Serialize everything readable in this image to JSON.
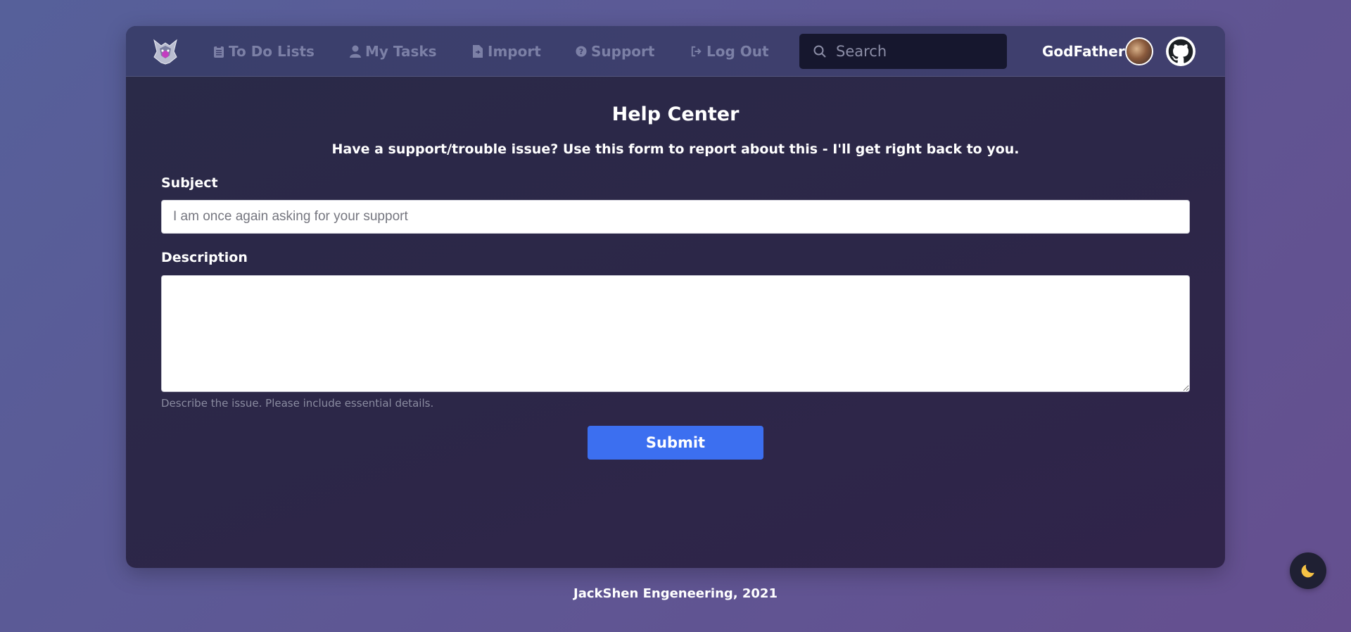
{
  "nav": {
    "items": [
      {
        "label": "To Do Lists",
        "icon": "clipboard-icon"
      },
      {
        "label": "My Tasks",
        "icon": "user-icon"
      },
      {
        "label": "Import",
        "icon": "file-import-icon"
      },
      {
        "label": "Support",
        "icon": "question-circle-icon"
      },
      {
        "label": "Log Out",
        "icon": "sign-out-icon"
      }
    ],
    "search_placeholder": "Search",
    "username": "GodFather"
  },
  "form": {
    "title": "Help Center",
    "subtitle": "Have a support/trouble issue? Use this form to report about this - I'll get right back to you.",
    "subject_label": "Subject",
    "subject_placeholder": "I am once again asking for your support",
    "description_label": "Description",
    "description_value": "",
    "description_hint": "Describe the issue. Please include essential details.",
    "submit_label": "Submit"
  },
  "footer": {
    "text": "JackShen Engeneering, 2021"
  },
  "colors": {
    "accent": "#3c6ff0",
    "nav_text": "#7c80a6",
    "card_bg": "#2c2748"
  }
}
